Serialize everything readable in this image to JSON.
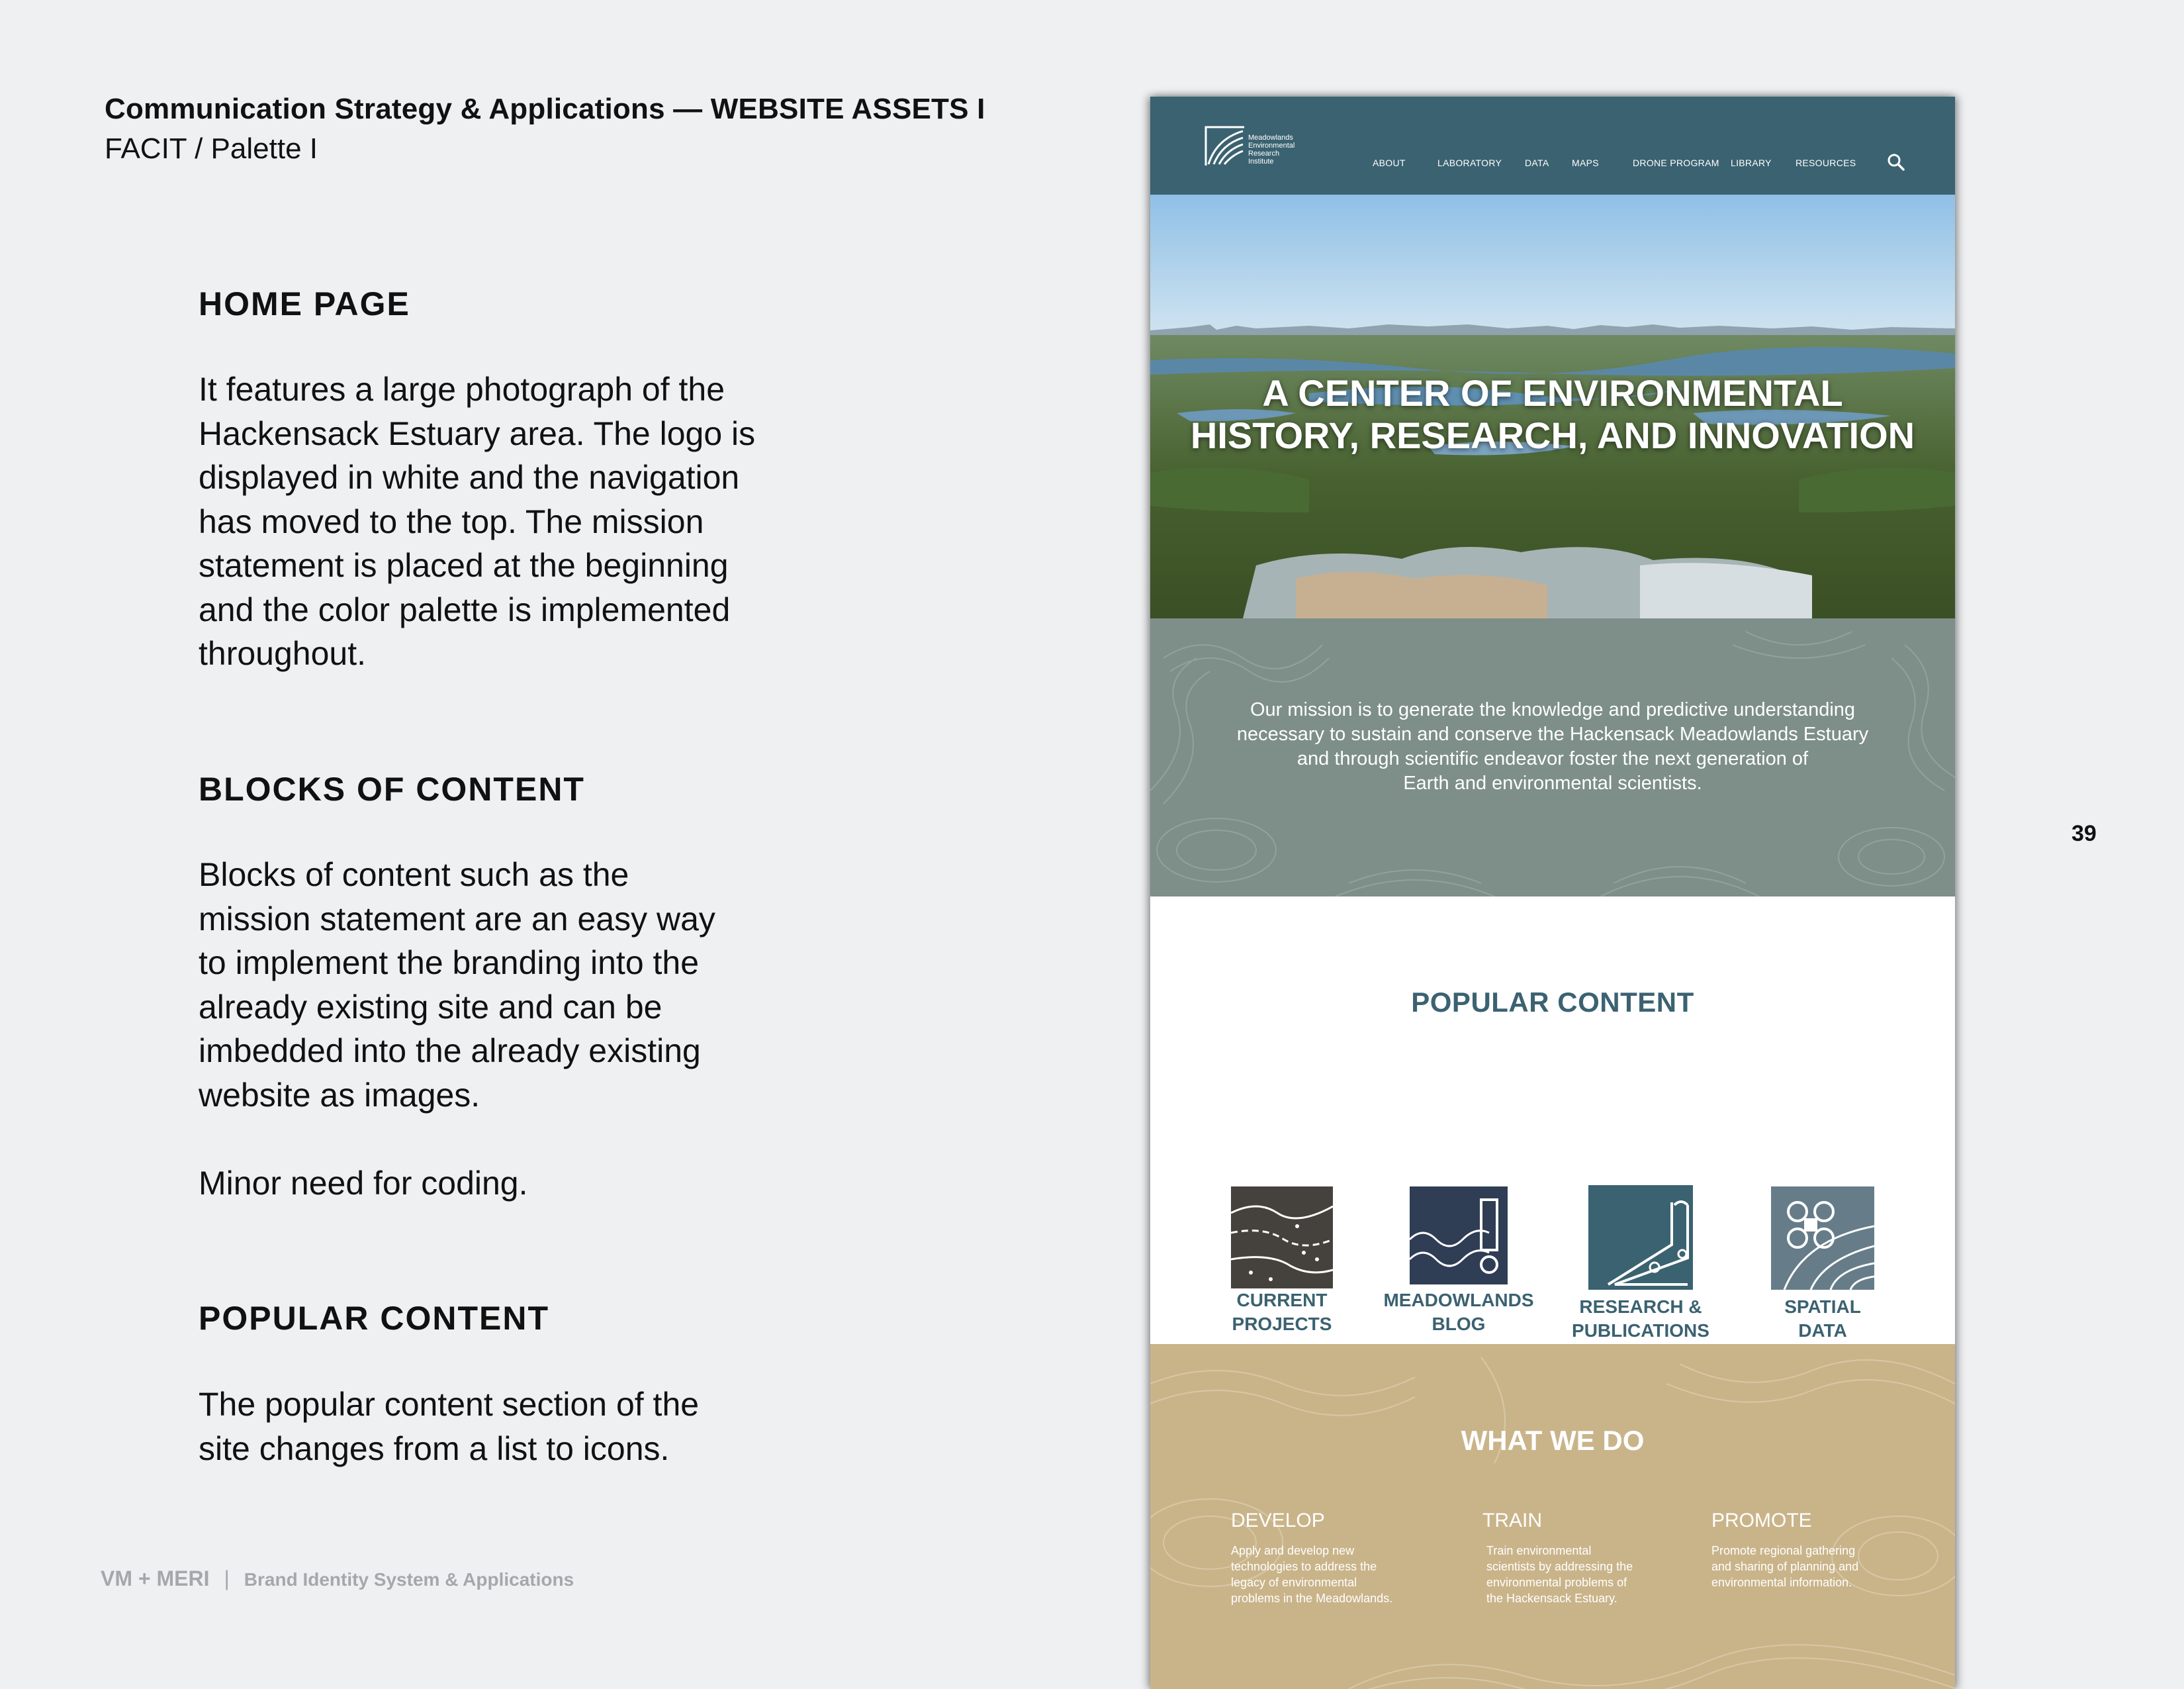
{
  "header": {
    "title": "Communication Strategy & Applications — WEBSITE ASSETS I",
    "subtitle": "FACIT / Palette I"
  },
  "sections": {
    "home": {
      "heading": "HOME PAGE",
      "lines": [
        "It features a large photograph of the",
        "Hackensack Estuary area. The logo is",
        "displayed in white and the navigation",
        "has moved to the top. The mission",
        "statement is placed at the beginning",
        "and the color palette is implemented",
        "throughout."
      ]
    },
    "blocks": {
      "heading": "BLOCKS OF CONTENT",
      "lines": [
        "Blocks of content such as the",
        "mission statement are an easy way",
        "to implement the branding into the",
        "already existing site and can be",
        "imbedded into the already existing",
        "website as images."
      ],
      "note": "Minor need for coding."
    },
    "popular": {
      "heading": "POPULAR CONTENT",
      "lines": [
        "The popular content section of the",
        "site changes from a list to icons."
      ]
    }
  },
  "footer": {
    "brand": "VM + MERI",
    "separator": "|",
    "label": "Brand Identity System & Applications"
  },
  "page_number": "39",
  "website": {
    "logo_lines": [
      "Meadowlands",
      "Environmental",
      "Research",
      "Institute"
    ],
    "nav": [
      "ABOUT",
      "LABORATORY",
      "DATA",
      "MAPS",
      "DRONE PROGRAM",
      "LIBRARY",
      "RESOURCES"
    ],
    "icons": {
      "search": "search-icon"
    },
    "hero_lines": [
      "A CENTER OF ENVIRONMENTAL",
      "HISTORY, RESEARCH, AND INNOVATION"
    ],
    "mission_lines": [
      "Our mission is to generate the knowledge and predictive understanding",
      "necessary to sustain and conserve the Hackensack Meadowlands Estuary",
      "and through scientific endeavor foster the next generation of",
      "Earth and environmental scientists."
    ],
    "popular_title": "POPULAR CONTENT",
    "popular_items": [
      {
        "lines": [
          "CURRENT",
          "PROJECTS"
        ],
        "icon": "current-projects-icon"
      },
      {
        "lines": [
          "MEADOWLANDS",
          "BLOG"
        ],
        "icon": "meadowlands-blog-icon"
      },
      {
        "lines": [
          "RESEARCH &",
          "PUBLICATIONS"
        ],
        "icon": "research-publications-icon"
      },
      {
        "lines": [
          "SPATIAL",
          "DATA"
        ],
        "icon": "spatial-data-icon"
      }
    ],
    "what_title": "WHAT WE DO",
    "what_cols": [
      {
        "heading": "DEVELOP",
        "lines": [
          "Apply and develop new",
          "technologies to address the",
          "legacy of environmental",
          "problems in the Meadowlands."
        ]
      },
      {
        "heading": "TRAIN",
        "lines": [
          "Train environmental",
          "scientists by addressing the",
          "environmental problems of",
          "the Hackensack Estuary."
        ]
      },
      {
        "heading": "PROMOTE",
        "lines": [
          "Promote regional gathering",
          "and sharing of planning and",
          "environmental information."
        ]
      }
    ],
    "colors": {
      "nav": "#3b6271",
      "mission": "#7d8f88",
      "accent": "#3b6271",
      "sand": "#c9b48a",
      "dark_tile": "#45413c",
      "navy_tile": "#2f3d55",
      "slate_tile": "#667d89"
    }
  }
}
